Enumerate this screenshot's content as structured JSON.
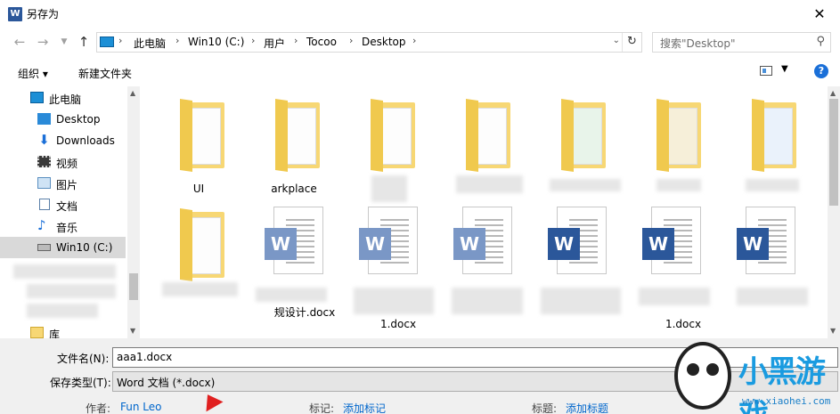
{
  "window": {
    "title": "另存为",
    "app_icon": "W"
  },
  "address": {
    "crumbs": [
      "此电脑",
      "Win10 (C:)",
      "用户",
      "Tocoo",
      "Desktop"
    ],
    "search_placeholder": "搜索\"Desktop\""
  },
  "toolbar": {
    "organize": "组织 ▾",
    "new_folder": "新建文件夹"
  },
  "sidebar": {
    "items": [
      {
        "label": "此电脑",
        "icon": "computer-icon"
      },
      {
        "label": "Desktop",
        "icon": "desktop-icon"
      },
      {
        "label": "Downloads",
        "icon": "download-icon"
      },
      {
        "label": "视频",
        "icon": "video-icon"
      },
      {
        "label": "图片",
        "icon": "picture-icon"
      },
      {
        "label": "文档",
        "icon": "document-icon"
      },
      {
        "label": "音乐",
        "icon": "music-icon"
      },
      {
        "label": "Win10 (C:)",
        "icon": "drive-icon"
      },
      {
        "label": "库",
        "icon": "library-icon"
      }
    ],
    "selected": "Win10 (C:)"
  },
  "content": {
    "folders": [
      {
        "label": "UI"
      },
      {
        "label": "arkplace"
      },
      {
        "label": ""
      },
      {
        "label": ""
      },
      {
        "label": ""
      },
      {
        "label": ""
      },
      {
        "label": ""
      }
    ],
    "docs": [
      {
        "label": ""
      },
      {
        "label": "规设计.docx"
      },
      {
        "label": "1.docx"
      },
      {
        "label": ""
      },
      {
        "label": ""
      },
      {
        "label": "1.docx"
      },
      {
        "label": ""
      }
    ]
  },
  "bottom": {
    "filename_label": "文件名(N):",
    "filename_value": "aaa1.docx",
    "filetype_label": "保存类型(T):",
    "filetype_value": "Word 文档 (*.docx)",
    "author_label": "作者:",
    "author_value": "Fun Leo",
    "tags_label": "标记:",
    "tags_value": "添加标记",
    "title_label": "标题:",
    "title_value": "添加标题"
  },
  "watermark": {
    "text": "小黑游戏",
    "url": "www.xiaohei.com"
  },
  "colors": {
    "accent": "#1a6fd8",
    "word": "#2b579a",
    "folder": "#f7d774",
    "link": "#0066cc"
  }
}
